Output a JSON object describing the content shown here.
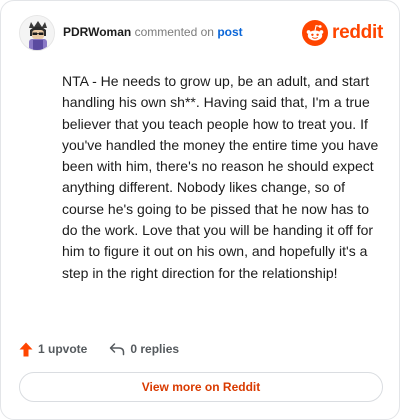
{
  "header": {
    "username": "PDRWoman",
    "verb": "commented on",
    "link_text": "post",
    "brand_name": "reddit"
  },
  "comment": {
    "body": "NTA - He needs to grow up, be an adult, and start handling his own sh**. Having said that, I'm a true believer that you teach people how to treat you. If you've handled the money the entire time you have been with him, there's no reason he should expect anything different. Nobody likes change, so of course he's going to be pissed that he now has to do the work. Love that you will be handing it off for him to figure it out on his own, and hopefully it's a step in the right direction for the relationship!"
  },
  "actions": {
    "upvote_label": "1 upvote",
    "replies_label": "0 replies",
    "upvote_icon": "upvote-arrow-icon",
    "reply_icon": "reply-arrow-icon"
  },
  "footer": {
    "view_more_label": "View more on Reddit"
  },
  "colors": {
    "brand_orange": "#ff4500",
    "link_blue": "#0a66d8",
    "cta_text": "#d93a00",
    "muted_text": "#555a5e"
  }
}
